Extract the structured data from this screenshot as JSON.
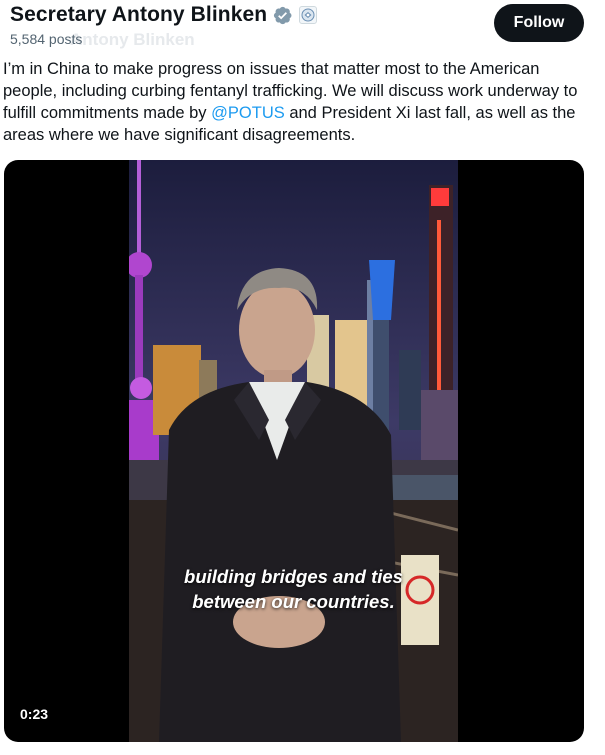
{
  "profile": {
    "name": "Secretary Antony Blinken",
    "posts": "5,584 posts",
    "ghost_name": "Antony Blinken"
  },
  "follow_label": "Follow",
  "tweet": {
    "text_before": "I’m in China to make progress on issues that matter most to the American people, including curbing fentanyl trafficking. We will discuss work underway to fulfill commitments made by ",
    "mention": "@POTUS",
    "text_after": " and President Xi last fall, as well as the areas where we have significant disagreements."
  },
  "video": {
    "caption_line1": "building bridges and ties",
    "caption_line2": "between our countries.",
    "timestamp": "0:23"
  },
  "icons": [
    "verified-badge-icon",
    "government-seal-icon"
  ],
  "colors": {
    "verified_badge": "#829aab",
    "mention": "#1d9bf0",
    "follow_bg": "#0f1419"
  }
}
